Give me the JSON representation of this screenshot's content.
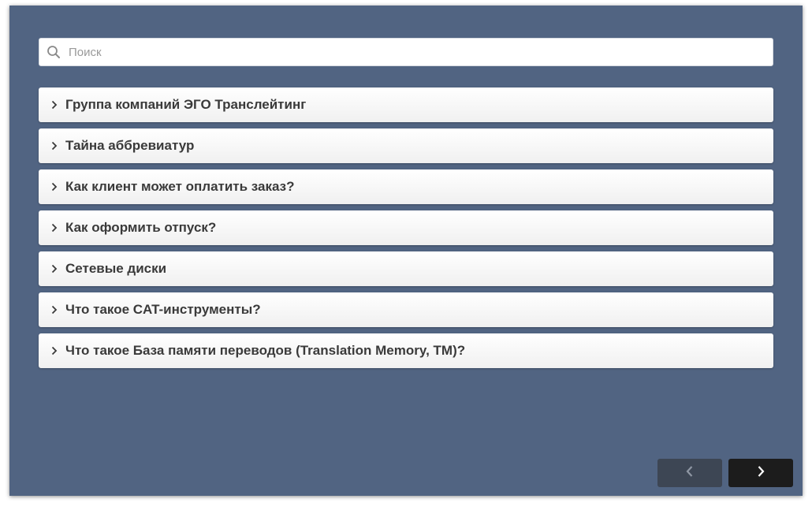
{
  "search": {
    "placeholder": "Поиск",
    "value": ""
  },
  "faq": {
    "items": [
      {
        "label": "Группа компаний ЭГО Транслейтинг"
      },
      {
        "label": "Тайна аббревиатур"
      },
      {
        "label": "Как клиент может оплатить заказ?"
      },
      {
        "label": "Как оформить отпуск?"
      },
      {
        "label": "Сетевые диски"
      },
      {
        "label": "Что такое CAT-инструменты?"
      },
      {
        "label": "Что такое База памяти переводов (Translation Memory, TM)?"
      }
    ]
  },
  "navigation": {
    "prev_icon": "chevron-left-icon",
    "next_icon": "chevron-right-icon"
  },
  "colors": {
    "background": "#516482",
    "prev_button": "#3d4654",
    "next_button": "#1c1c1c"
  }
}
